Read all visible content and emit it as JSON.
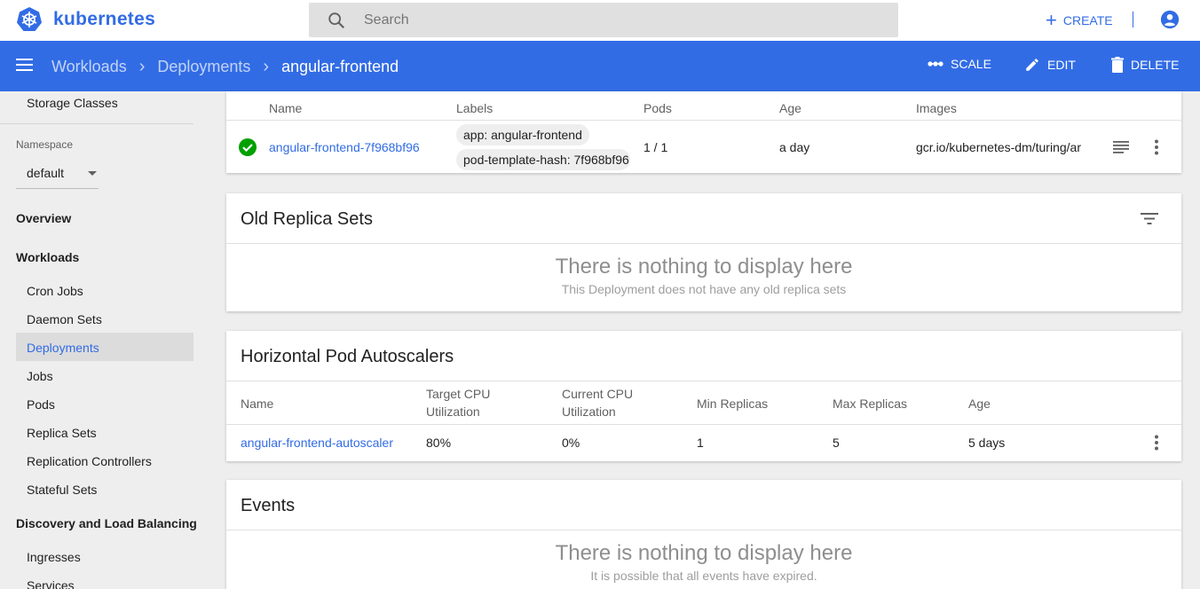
{
  "app": {
    "brand": "kubernetes"
  },
  "search": {
    "placeholder": "Search"
  },
  "topbar": {
    "create_label": "CREATE"
  },
  "breadcrumb": {
    "items": [
      "Workloads",
      "Deployments"
    ],
    "current": "angular-frontend"
  },
  "actions": {
    "scale": "SCALE",
    "edit": "EDIT",
    "delete": "DELETE"
  },
  "sidebar": {
    "top_item": "Storage Classes",
    "namespace_label": "Namespace",
    "namespace_value": "default",
    "overview": "Overview",
    "workloads": "Workloads",
    "workload_items": [
      "Cron Jobs",
      "Daemon Sets",
      "Deployments",
      "Jobs",
      "Pods",
      "Replica Sets",
      "Replication Controllers",
      "Stateful Sets"
    ],
    "active_item": "Deployments",
    "discovery": "Discovery and Load Balancing",
    "discovery_items": [
      "Ingresses",
      "Services"
    ]
  },
  "replica_set": {
    "headers": [
      "Name",
      "Labels",
      "Pods",
      "Age",
      "Images"
    ],
    "row": {
      "name": "angular-frontend-7f968bf96",
      "labels": [
        "app: angular-frontend",
        "pod-template-hash: 7f968bf96"
      ],
      "pods": "1 / 1",
      "age": "a day",
      "images": "gcr.io/kubernetes-dm/turing/ar"
    }
  },
  "old_replica_sets": {
    "title": "Old Replica Sets",
    "empty_title": "There is nothing to display here",
    "empty_sub": "This Deployment does not have any old replica sets"
  },
  "hpa": {
    "title": "Horizontal Pod Autoscalers",
    "headers": {
      "name": "Name",
      "target_1": "Target CPU",
      "target_2": "Utilization",
      "current_1": "Current CPU",
      "current_2": "Utilization",
      "min": "Min Replicas",
      "max": "Max Replicas",
      "age": "Age"
    },
    "row": {
      "name": "angular-frontend-autoscaler",
      "target": "80%",
      "current": "0%",
      "min": "1",
      "max": "5",
      "age": "5 days"
    }
  },
  "events": {
    "title": "Events",
    "empty_title": "There is nothing to display here",
    "empty_sub": "It is possible that all events have expired."
  },
  "colors": {
    "brand_blue": "#326ce5",
    "success_green": "#00a000",
    "background": "#eeeeee"
  }
}
